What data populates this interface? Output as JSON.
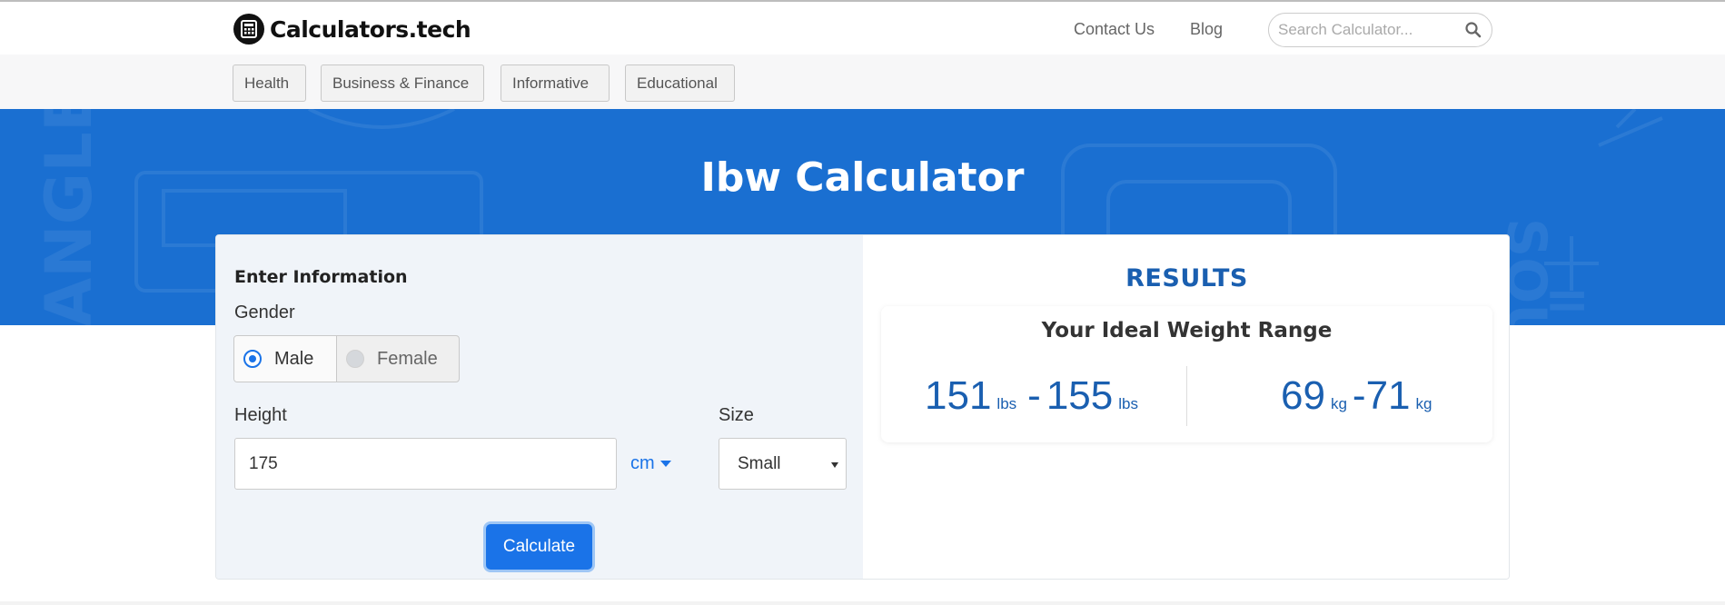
{
  "header": {
    "logo_text": "Calculators.tech",
    "nav": {
      "contact": "Contact Us",
      "blog": "Blog"
    },
    "search": {
      "placeholder": "Search Calculator..."
    }
  },
  "categories": [
    "Health",
    "Business & Finance",
    "Informative",
    "Educational"
  ],
  "hero": {
    "title": "Ibw Calculator"
  },
  "form": {
    "section_title": "Enter Information",
    "gender_label": "Gender",
    "gender_options": {
      "male": "Male",
      "female": "Female"
    },
    "gender_selected": "Male",
    "height_label": "Height",
    "height_value": "175",
    "height_unit": "cm",
    "size_label": "Size",
    "size_value": "Small",
    "calculate_label": "Calculate"
  },
  "results": {
    "title": "RESULTS",
    "subtitle": "Your Ideal Weight Range",
    "lbs_min": "151",
    "lbs_max": "155",
    "lbs_unit": "lbs",
    "kg_min": "69",
    "kg_max": "71",
    "kg_unit": "kg",
    "range_sep": "-"
  },
  "colors": {
    "accent": "#1a73e8",
    "hero_bg": "#1a6fd1",
    "results_text": "#1a5fb0"
  },
  "icons": {
    "logo": "calculator-icon",
    "search": "search-icon"
  }
}
